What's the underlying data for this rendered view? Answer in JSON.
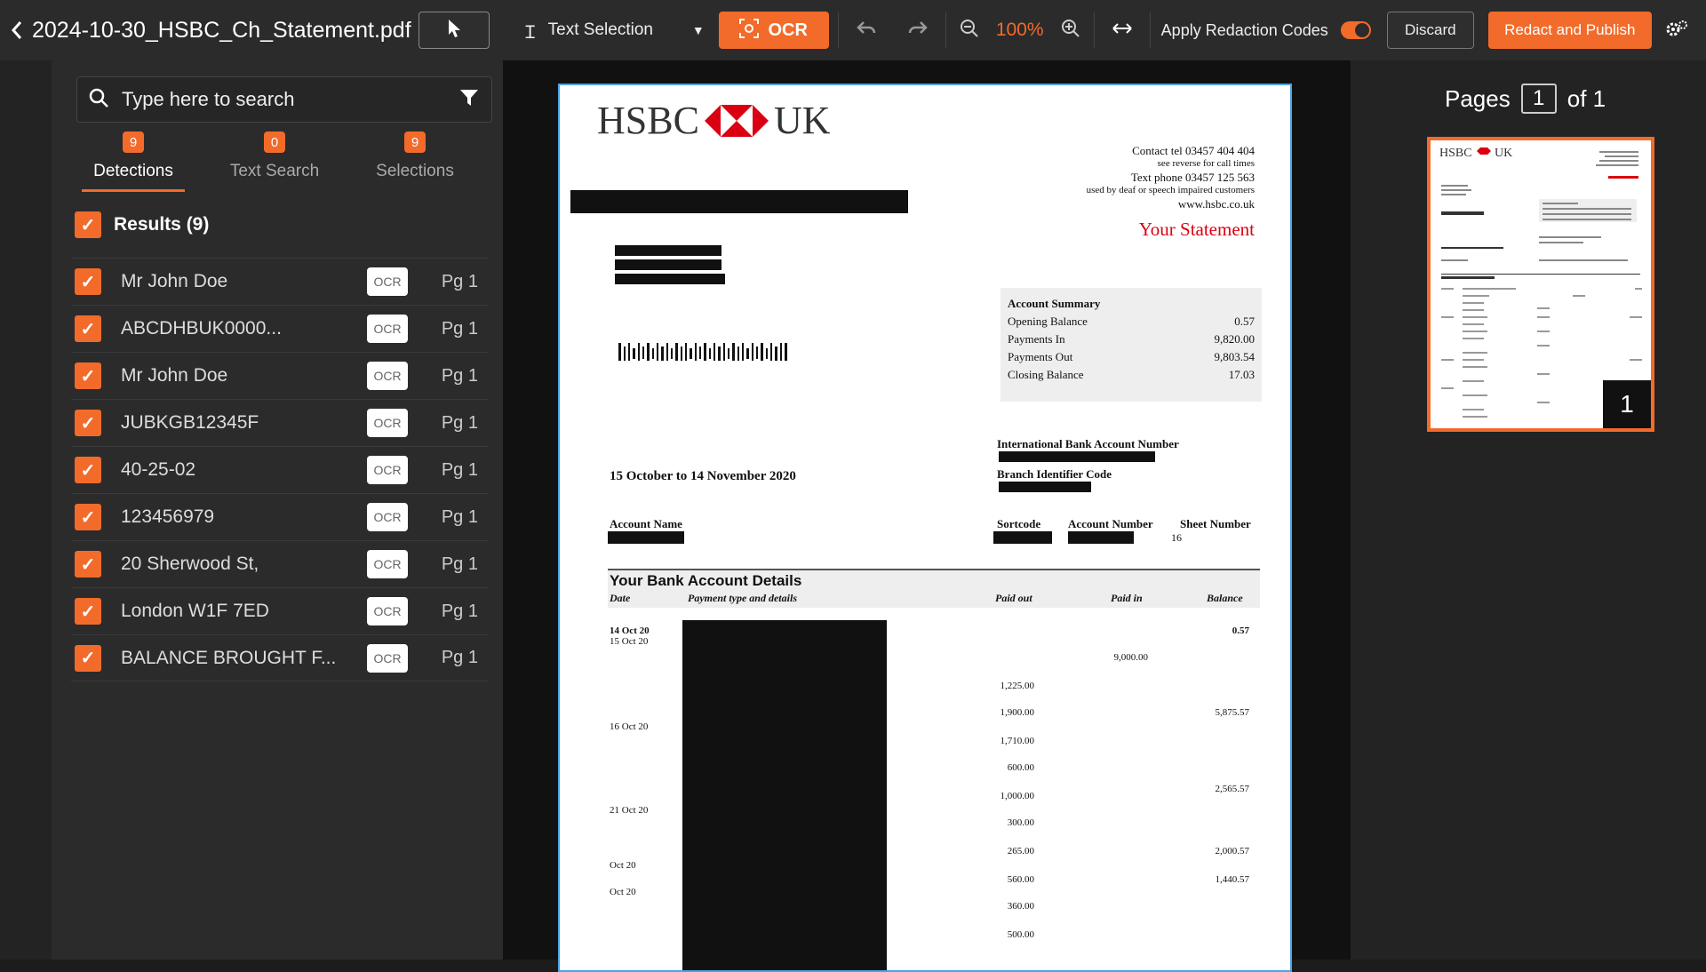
{
  "header": {
    "title": "2024-10-30_HSBC_Ch_Statement.pdf",
    "selection_mode": "Text Selection",
    "ocr_label": "OCR",
    "zoom": "100%",
    "apply_redaction_label": "Apply Redaction Codes",
    "apply_redaction_on": true,
    "discard_label": "Discard",
    "publish_label": "Redact and Publish"
  },
  "search": {
    "placeholder": "Type here to search"
  },
  "tabs": [
    {
      "label": "Detections",
      "count": "9",
      "active": true
    },
    {
      "label": "Text Search",
      "count": "0",
      "active": false
    },
    {
      "label": "Selections",
      "count": "9",
      "active": false
    }
  ],
  "results": {
    "label": "Results (9)",
    "items": [
      {
        "text": "Mr John Doe",
        "tag": "OCR",
        "page": "Pg 1"
      },
      {
        "text": "ABCDHBUK0000...",
        "tag": "OCR",
        "page": "Pg 1"
      },
      {
        "text": "Mr John Doe",
        "tag": "OCR",
        "page": "Pg 1"
      },
      {
        "text": "JUBKGB12345F",
        "tag": "OCR",
        "page": "Pg 1"
      },
      {
        "text": "40-25-02",
        "tag": "OCR",
        "page": "Pg 1"
      },
      {
        "text": "123456979",
        "tag": "OCR",
        "page": "Pg 1"
      },
      {
        "text": "20 Sherwood St,",
        "tag": "OCR",
        "page": "Pg 1"
      },
      {
        "text": "London W1F 7ED",
        "tag": "OCR",
        "page": "Pg 1"
      },
      {
        "text": "BALANCE BROUGHT F...",
        "tag": "OCR",
        "page": "Pg 1"
      }
    ]
  },
  "pages": {
    "label": "Pages",
    "current": "1",
    "of_label": "of 1",
    "thumb_number": "1"
  },
  "document": {
    "logo_left": "HSBC",
    "logo_right": "UK",
    "contact": [
      "Contact tel 03457 404 404",
      "see reverse for call times",
      "Text phone 03457 125 563",
      "used by deaf or speech impaired customers",
      "www.hsbc.co.uk"
    ],
    "statement_title": "Your Statement",
    "summary": {
      "title": "Account Summary",
      "rows": [
        {
          "label": "Opening Balance",
          "value": "0.57"
        },
        {
          "label": "Payments In",
          "value": "9,820.00"
        },
        {
          "label": "Payments Out",
          "value": "9,803.54"
        },
        {
          "label": "Closing Balance",
          "value": "17.03"
        }
      ]
    },
    "iban_label": "International Bank Account Number",
    "bic_label": "Branch Identifier Code",
    "period": "15 October to 14 November 2020",
    "account_name_label": "Account Name",
    "sortcode_label": "Sortcode",
    "account_number_label": "Account Number",
    "sheet_number_label": "Sheet Number",
    "sheet_number": "16",
    "details_title": "Your Bank Account Details",
    "columns": {
      "date": "Date",
      "type": "Payment type and details",
      "out": "Paid out",
      "in": "Paid in",
      "balance": "Balance"
    },
    "transactions": [
      {
        "date": "14 Oct 20",
        "out": "",
        "in": "",
        "balance": "0.57"
      },
      {
        "date": "15 Oct 20",
        "out": "",
        "in": "",
        "balance": ""
      },
      {
        "date": "",
        "out": "",
        "in": "9,000.00",
        "balance": ""
      },
      {
        "date": "",
        "out": "1,225.00",
        "in": "",
        "balance": ""
      },
      {
        "date": "",
        "out": "1,900.00",
        "in": "",
        "balance": "5,875.57"
      },
      {
        "date": "16 Oct 20",
        "out": "",
        "in": "",
        "balance": ""
      },
      {
        "date": "",
        "out": "1,710.00",
        "in": "",
        "balance": ""
      },
      {
        "date": "",
        "out": "600.00",
        "in": "",
        "balance": ""
      },
      {
        "date": "",
        "out": "1,000.00",
        "in": "",
        "balance": "2,565.57"
      },
      {
        "date": "21 Oct 20",
        "out": "",
        "in": "",
        "balance": ""
      },
      {
        "date": "",
        "out": "300.00",
        "in": "",
        "balance": ""
      },
      {
        "date": "",
        "out": "265.00",
        "in": "",
        "balance": "2,000.57"
      },
      {
        "date": "Oct 20",
        "out": "",
        "in": "",
        "balance": ""
      },
      {
        "date": "",
        "out": "560.00",
        "in": "",
        "balance": "1,440.57"
      },
      {
        "date": "Oct 20",
        "out": "",
        "in": "",
        "balance": ""
      },
      {
        "date": "",
        "out": "360.00",
        "in": "",
        "balance": ""
      },
      {
        "date": "",
        "out": "500.00",
        "in": "",
        "balance": ""
      }
    ]
  },
  "colors": {
    "accent": "#f26b2a",
    "hsbc_red": "#db0011",
    "background": "#1c1c1c"
  },
  "icons": [
    "back-chevron-icon",
    "cursor-icon",
    "text-cursor-icon",
    "dropdown-caret-icon",
    "ocr-scan-icon",
    "undo-icon",
    "redo-icon",
    "zoom-out-icon",
    "zoom-in-icon",
    "fit-width-icon",
    "settings-icon",
    "search-icon",
    "filter-icon",
    "checkbox-icon"
  ]
}
